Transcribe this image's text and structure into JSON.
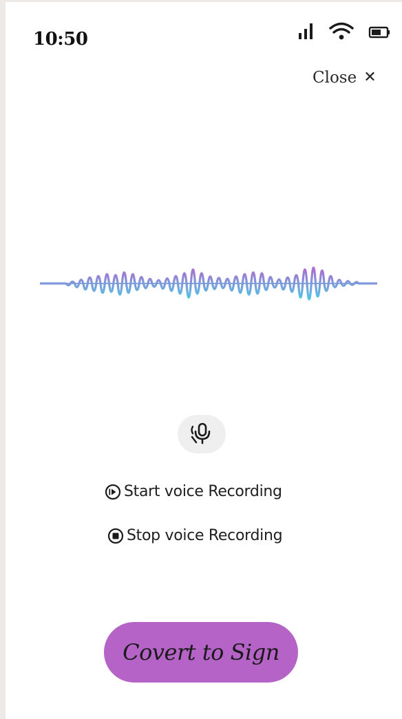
{
  "status_bar": {
    "time": "10:50",
    "icons": [
      "signal-icon",
      "wifi-icon",
      "battery-icon"
    ]
  },
  "header": {
    "close_label": "Close",
    "close_icon": "close-icon"
  },
  "waveform": {
    "icon": "audio-waveform",
    "colors": [
      "#b06ad0",
      "#4fc6e6"
    ],
    "baseline_color": "#7fa9d8"
  },
  "mic_button": {
    "icon": "voice-mic-icon"
  },
  "recording": {
    "start_label": "Start voice Recording",
    "start_icon": "play-circle-icon",
    "stop_label": "Stop voice Recording",
    "stop_icon": "stop-circle-icon"
  },
  "convert_button": {
    "label": "Covert to Sign",
    "background": "#b563c7"
  }
}
